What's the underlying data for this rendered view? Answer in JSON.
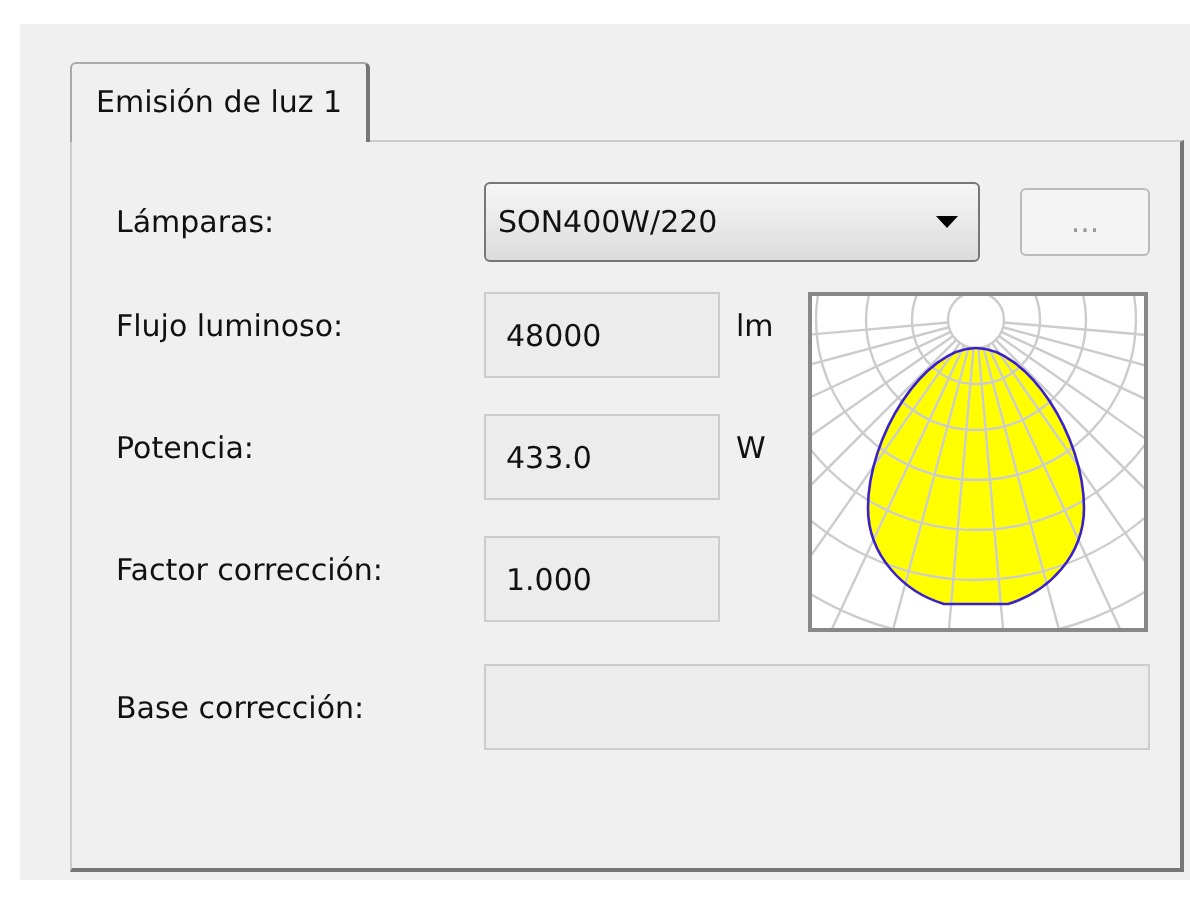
{
  "tabs": [
    {
      "label": "Emisión de luz 1",
      "selected": true
    }
  ],
  "lamp": {
    "label": "Lámparas:",
    "value": "SON400W/220",
    "browse_button": "..."
  },
  "fields": [
    {
      "label": "Flujo luminoso:",
      "value": "48000",
      "unit": "lm"
    },
    {
      "label": "Potencia:",
      "value": "433.0",
      "unit": "W"
    },
    {
      "label": "Factor corrección:",
      "value": "1.000"
    }
  ],
  "base": {
    "label": "Base corrección:"
  }
}
